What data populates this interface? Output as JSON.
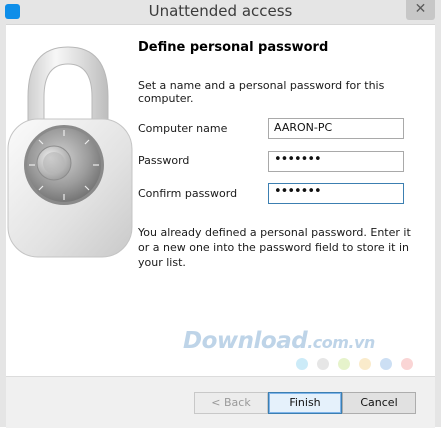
{
  "window": {
    "title": "Unattended access",
    "close_glyph": "✕",
    "app_icon": "teamviewer-icon",
    "accent": "#0e8ee9"
  },
  "content": {
    "heading": "Define personal password",
    "intro": "Set a name and a personal password for this computer.",
    "fields": {
      "computer_name": {
        "label": "Computer name",
        "value": "AARON-PC"
      },
      "password": {
        "label": "Password",
        "value": "•••••••"
      },
      "confirm_password": {
        "label": "Confirm password",
        "value": "•••••••"
      }
    },
    "note": "You already defined a personal password. Enter it or a new one into the password field to store it in your list."
  },
  "watermark": {
    "brand": "Download",
    "domain": ".com.vn",
    "dot_colors": [
      "#8fd2ef",
      "#c8c8c8",
      "#c7e58b",
      "#f5d38b",
      "#8fb8e6",
      "#f5a2a2"
    ]
  },
  "buttons": {
    "back": "< Back",
    "finish": "Finish",
    "cancel": "Cancel"
  },
  "illustration": "padlock-icon"
}
